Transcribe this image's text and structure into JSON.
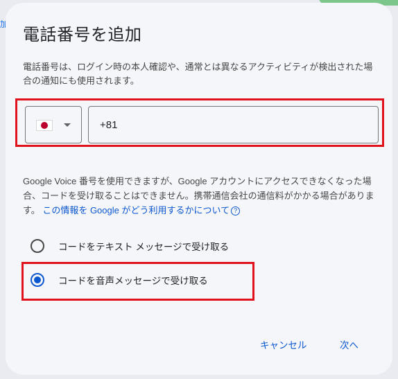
{
  "background": {
    "edge_text": "加"
  },
  "dialog": {
    "title": "電話番号を追加",
    "description": "電話番号は、ログイン時の本人確認や、通常とは異なるアクティビティが検出された場合の通知にも使用されます。",
    "country_select": {
      "flag": "japan-flag-icon",
      "dropdown_icon": "caret-down-icon"
    },
    "phone_input": {
      "value": "+81"
    },
    "voice_note": "Google Voice 番号を使用できますが、Google アカウントにアクセスできなくなった場合、コードを受け取ることはできません。携帯通信会社の通信料がかかる場合があります。",
    "voice_note_link": "この情報を Google がどう利用するかについて",
    "help_icon": "?",
    "options": [
      {
        "label": "コードをテキスト メッセージで受け取る",
        "checked": false
      },
      {
        "label": "コードを音声メッセージで受け取る",
        "checked": true
      }
    ],
    "buttons": {
      "cancel": "キャンセル",
      "next": "次へ"
    }
  },
  "colors": {
    "accent": "#0b57d0",
    "highlight": "#e0111b",
    "dialog_bg": "#f5f6f9"
  }
}
